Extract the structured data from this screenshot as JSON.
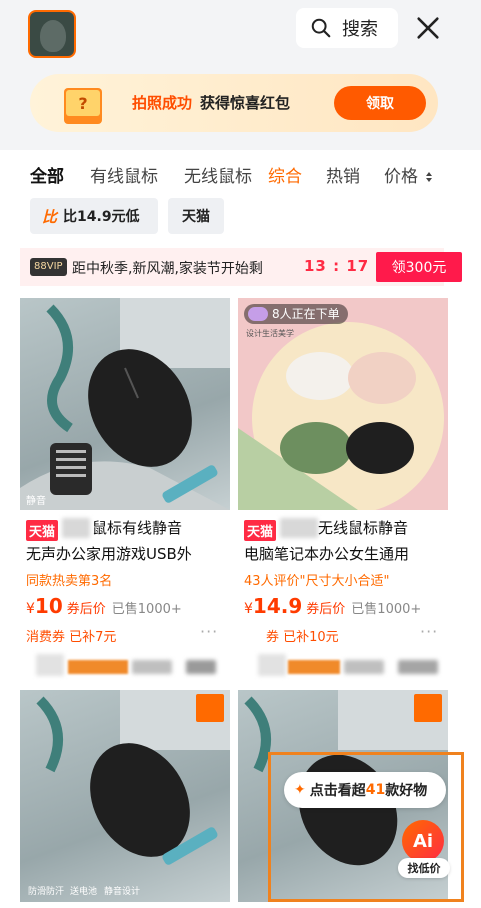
{
  "header": {
    "search_label": "搜索",
    "promo": {
      "highlight": "拍照成功",
      "text": "获得惊喜红包",
      "claim_label": "领取",
      "gift_mark": "?"
    }
  },
  "tabs": [
    "全部",
    "有线鼠标",
    "无线鼠标",
    "综合",
    "热销",
    "价格"
  ],
  "filters": {
    "price_chip": "比14.9元低",
    "tmall_chip": "天猫",
    "price_icon": "比"
  },
  "banner": {
    "vip": "88VIP",
    "text": "距中秋季,新风潮,家装节开始剩",
    "timer": "13 : 17 : 4",
    "button": "领300元"
  },
  "products": [
    {
      "badge": "天猫",
      "title_line1": "鼠标有线静音",
      "title_line2": "无声办公家用游戏USB外",
      "sub": "同款热卖第3名",
      "currency": "¥",
      "price": "10",
      "price_label": "券后价",
      "sold": "已售1000+",
      "coupon": "消费券 已补7元",
      "image_caption": "静音"
    },
    {
      "badge": "天猫",
      "title_line1": "无线鼠标静音",
      "title_line2": "电脑笔记本办公女生通用",
      "sub": "43人评价\"尺寸大小合适\"",
      "currency": "¥",
      "price": "14.9",
      "price_label": "券后价",
      "sold": "已售1000+",
      "coupon": "券 已补10元",
      "ordering": "8人正在下单",
      "brand_caption": "设计生活美学"
    }
  ],
  "lower_cards": {
    "features": [
      "防滑防汗",
      "送电池",
      "静音设计"
    ]
  },
  "float": {
    "see_more_prefix": "点击看超",
    "count": "41",
    "see_more_suffix": "款好物",
    "ai_label": "Ai",
    "ai_text": "找低价"
  },
  "colors": {
    "accent": "#ff6a00",
    "price": "#ff3b00",
    "tmall_red": "#ff2b44",
    "highlight_border": "#f0821e"
  }
}
